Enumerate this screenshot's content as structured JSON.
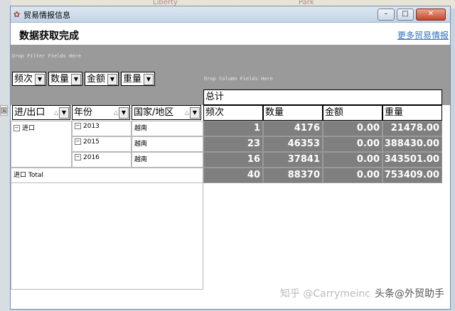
{
  "background": {
    "map_text_1": "Liberty",
    "map_text_2": "Park",
    "side_label": "国"
  },
  "window": {
    "title": "贸易情报信息",
    "min_label": "–",
    "max_label": "□",
    "close_label": "✕"
  },
  "header": {
    "heading": "数据获取完成",
    "more_link": "更多贸易情报"
  },
  "pivot": {
    "filter_hint": "Drop Filter Fields Here",
    "column_hint": "Drop Column Fields Here",
    "data_fields": [
      "频次",
      "数量",
      "金额",
      "重量"
    ],
    "row_fields": [
      "进/出口",
      "年份",
      "国家/地区"
    ],
    "grand_total_label": "总计",
    "value_headers": [
      "频次",
      "数量",
      "金额",
      "重量"
    ],
    "direction": "进口",
    "rows": [
      {
        "year": "2013",
        "country": "越南",
        "values": [
          "1",
          "4176",
          "0.00",
          "21478.00"
        ]
      },
      {
        "year": "2015",
        "country": "越南",
        "values": [
          "23",
          "46353",
          "0.00",
          "388430.00"
        ]
      },
      {
        "year": "2016",
        "country": "越南",
        "values": [
          "16",
          "37841",
          "0.00",
          "343501.00"
        ]
      }
    ],
    "total_label": "进口 Total",
    "total_values": [
      "40",
      "88370",
      "0.00",
      "753409.00"
    ]
  },
  "watermark": {
    "ghost": "知乎 @Carrymeinc",
    "text": "头条@外贸助手"
  }
}
